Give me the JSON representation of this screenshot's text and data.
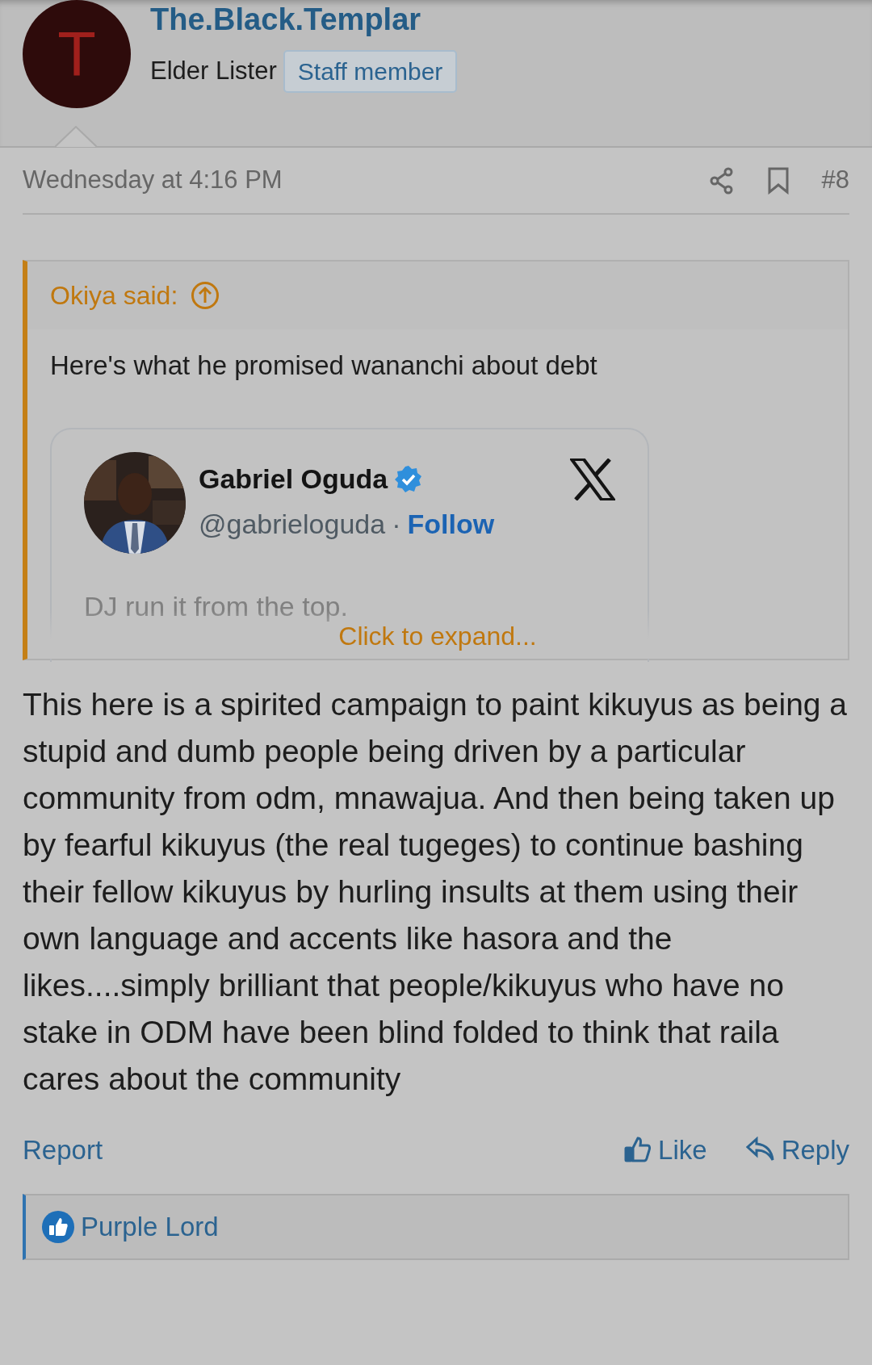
{
  "post": {
    "avatar_letter": "T",
    "username": "The.Black.Templar",
    "user_title": "Elder Lister",
    "user_badge": "Staff member",
    "date": "Wednesday at 4:16 PM",
    "post_number": "#8"
  },
  "quote": {
    "author": "Okiya said:",
    "text": "Here's what he promised wananchi about debt",
    "embed": {
      "name": "Gabriel Oguda",
      "verified": true,
      "handle": "@gabrieloguda",
      "separator": "·",
      "follow": "Follow",
      "text": "DJ run it from the top."
    },
    "expand": "Click to expand..."
  },
  "body": "This here is a spirited campaign to paint kikuyus as being a stupid and dumb people being driven by a particular community from odm, mnawajua. And then being taken up by fearful kikuyus (the real tugeges) to continue bashing their fellow kikuyus by hurling insults at them using their own language and accents like hasora and the likes....simply brilliant that people/kikuyus who have no stake in ODM have been blind folded to think that raila cares about the community",
  "actions": {
    "left": [
      "Report"
    ],
    "right": [
      {
        "kind": "like",
        "label": "Like"
      },
      {
        "kind": "reply",
        "label": "Reply"
      }
    ]
  },
  "reactions": {
    "users": "Purple Lord"
  }
}
